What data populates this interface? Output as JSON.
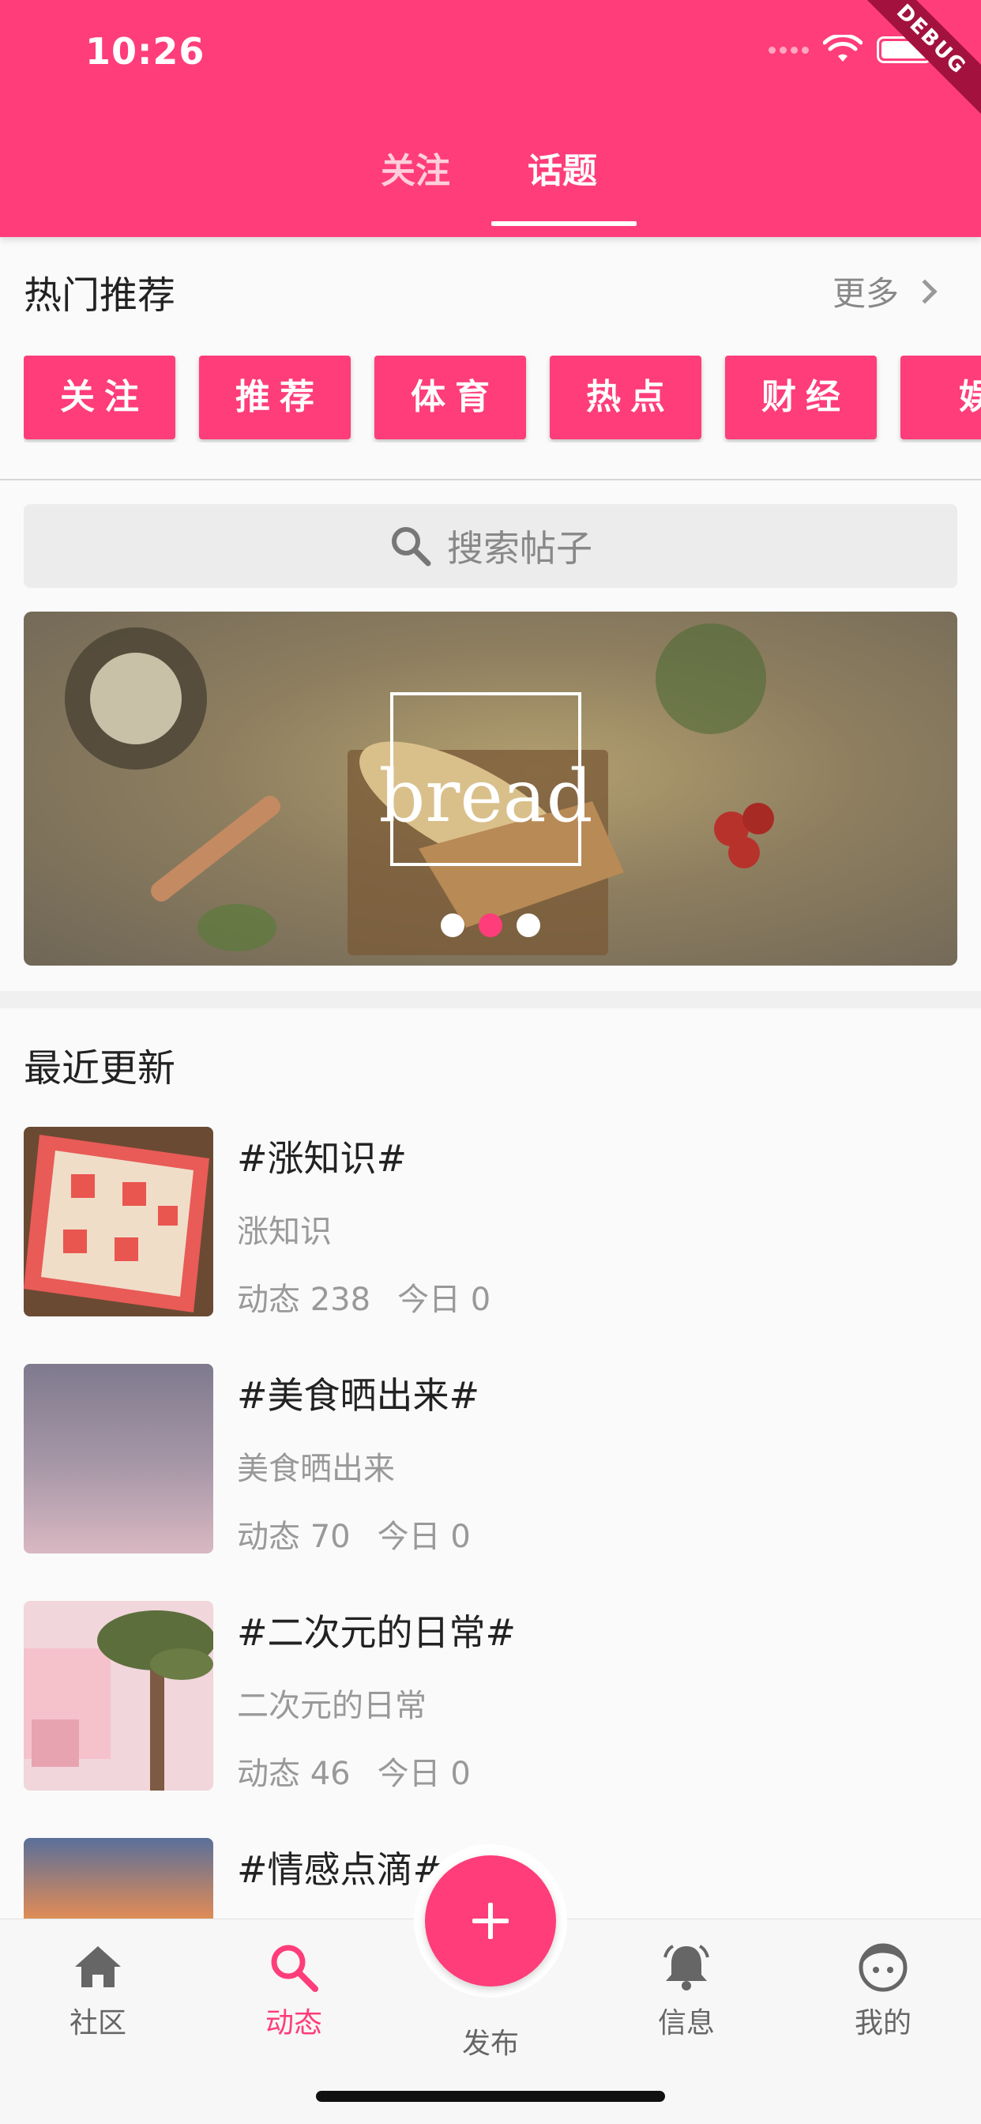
{
  "status_bar": {
    "time": "10:26",
    "debug_banner": "DEBUG"
  },
  "tabs": [
    {
      "label": "关注",
      "active": false
    },
    {
      "label": "话题",
      "active": true
    }
  ],
  "hot": {
    "title": "热门推荐",
    "more_label": "更多",
    "chips": [
      "关注",
      "推荐",
      "体育",
      "热点",
      "财经",
      "娱"
    ]
  },
  "search": {
    "placeholder": "搜索帖子"
  },
  "banner": {
    "text": "bread",
    "slide_count": 3,
    "active_index": 1
  },
  "recent": {
    "title": "最近更新",
    "items": [
      {
        "title": "#涨知识#",
        "subtitle": "涨知识",
        "posts": "动态 238",
        "today": "今日 0"
      },
      {
        "title": "#美食晒出来#",
        "subtitle": "美食晒出来",
        "posts": "动态 70",
        "today": "今日 0"
      },
      {
        "title": "#二次元的日常#",
        "subtitle": "二次元的日常",
        "posts": "动态 46",
        "today": "今日 0"
      },
      {
        "title": "#情感点滴#",
        "subtitle": "",
        "posts": "",
        "today": ""
      }
    ]
  },
  "bottom_nav": [
    {
      "label": "社区",
      "icon": "home-icon",
      "active": false
    },
    {
      "label": "动态",
      "icon": "search-icon",
      "active": true
    },
    {
      "label": "发布",
      "icon": "plus-icon",
      "active": false
    },
    {
      "label": "信息",
      "icon": "bell-icon",
      "active": false
    },
    {
      "label": "我的",
      "icon": "face-icon",
      "active": false
    }
  ],
  "colors": {
    "accent": "#fe3d7a",
    "page_bg": "#fafafa",
    "muted_text": "#999999"
  }
}
